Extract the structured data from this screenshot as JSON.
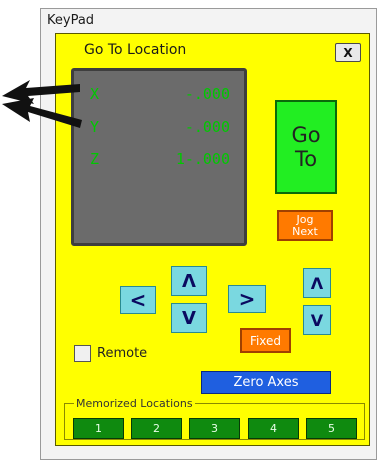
{
  "window": {
    "title": "KeyPad"
  },
  "keypad": {
    "title": "Go To Location",
    "close_label": "X",
    "coords": [
      {
        "axis": "X",
        "value": "-.000"
      },
      {
        "axis": "Y",
        "value": "-.000"
      },
      {
        "axis": "Z",
        "value": "1-.000"
      }
    ],
    "go_label_line1": "Go",
    "go_label_line2": "To",
    "jog_line1": "Jog",
    "jog_line2": "Next",
    "left_label": "<",
    "right_label": ">",
    "up_label": "Λ",
    "down_label": "V",
    "z_up_label": "Λ",
    "z_down_label": "V",
    "fixed_label": "Fixed",
    "remote_label": "Remote",
    "remote_checked": false,
    "zero_label": "Zero Axes",
    "memorized_title": "Memorized Locations",
    "memorized": [
      "1",
      "2",
      "3",
      "4",
      "5"
    ]
  },
  "colors": {
    "panel": "#ffff00",
    "display": "#6b6b6b",
    "readout": "#00c800",
    "go": "#22ee22",
    "jog": "#ff7a00",
    "zero": "#1f5fe0",
    "memory": "#0f8a0f"
  }
}
